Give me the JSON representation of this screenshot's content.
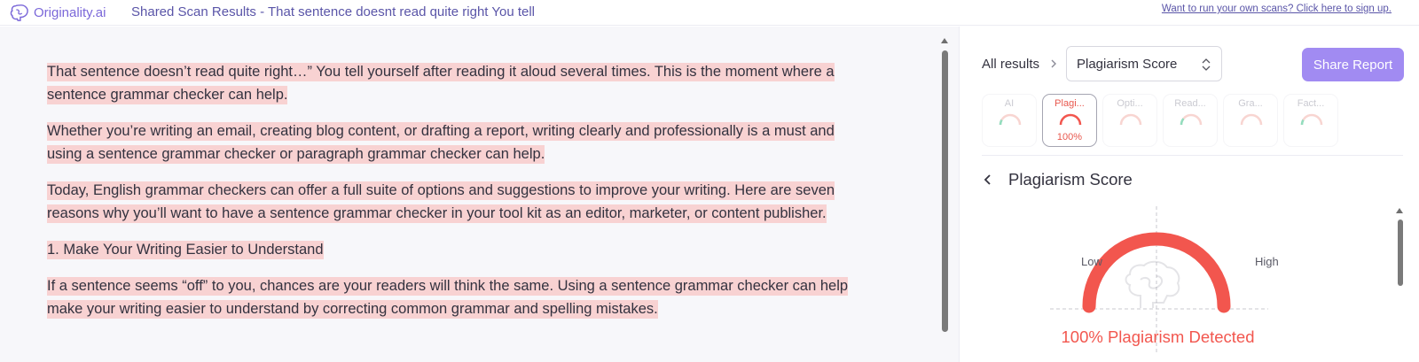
{
  "header": {
    "brand": "Originality.ai",
    "title": "Shared Scan Results - That sentence doesnt read quite right You tell",
    "signup_link": "Want to run your own scans? Click here to sign up."
  },
  "document": {
    "paragraphs": [
      "That sentence doesn’t read quite right…” You tell yourself after reading it aloud several times. This is the moment where a sentence grammar checker can help.",
      "Whether you’re writing an email, creating blog content, or drafting a report, writing clearly and professionally is a must and using a sentence grammar checker or paragraph grammar checker can help.",
      "Today, English grammar checkers can offer a full suite of options and suggestions to improve your writing. Here are seven reasons why you’ll want to have a sentence grammar checker in your tool kit as an editor, marketer, or content publisher.",
      "1. Make Your Writing Easier to Understand",
      "If a sentence seems “off” to you, chances are your readers will think the same. Using a sentence grammar checker can help make your writing easier to understand by correcting common grammar and spelling mistakes."
    ],
    "highlight_color": "#f8d2d2"
  },
  "results": {
    "breadcrumb": "All results",
    "select_value": "Plagiarism Score",
    "share_button": "Share Report",
    "tabs": [
      {
        "label": "AI",
        "value": "",
        "active": false
      },
      {
        "label": "Plagi...",
        "value": "100%",
        "active": true
      },
      {
        "label": "Opti...",
        "value": "",
        "active": false
      },
      {
        "label": "Read...",
        "value": "",
        "active": false
      },
      {
        "label": "Gra...",
        "value": "",
        "active": false
      },
      {
        "label": "Fact...",
        "value": "",
        "active": false
      }
    ],
    "detail": {
      "title": "Plagiarism Score",
      "low_label": "Low",
      "high_label": "High",
      "score_percent": 100,
      "summary": "100% Plagiarism Detected"
    },
    "colors": {
      "accent": "#a18bf2",
      "danger": "#f2564e"
    }
  }
}
